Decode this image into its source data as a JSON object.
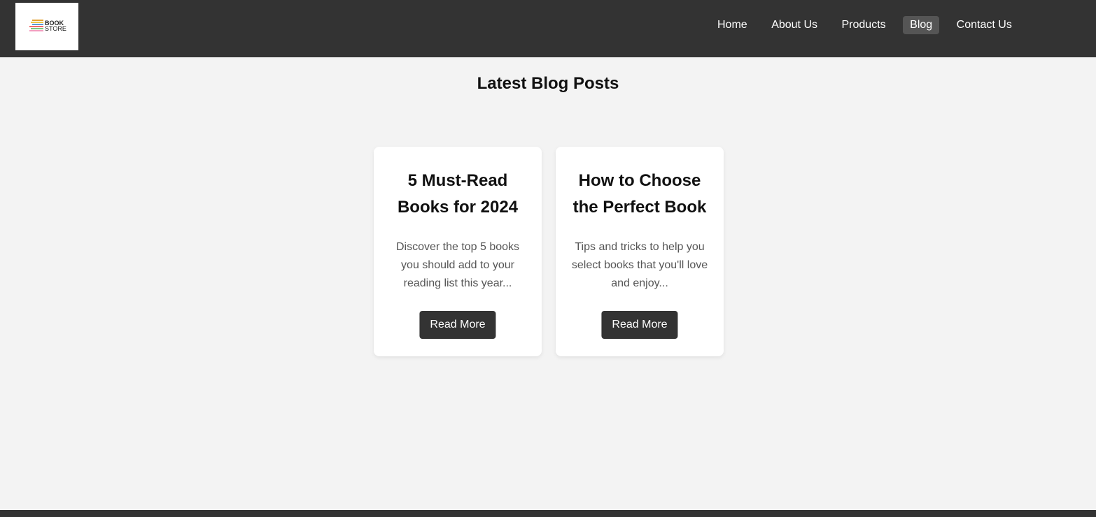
{
  "header": {
    "logo": {
      "line1": "BOOK",
      "line2": "STORE"
    },
    "nav": [
      {
        "label": "Home",
        "active": false
      },
      {
        "label": "About Us",
        "active": false
      },
      {
        "label": "Products",
        "active": false
      },
      {
        "label": "Blog",
        "active": true
      },
      {
        "label": "Contact Us",
        "active": false
      }
    ]
  },
  "main": {
    "title": "Latest Blog Posts",
    "posts": [
      {
        "title": "5 Must-Read Books for 2024",
        "excerpt": "Discover the top 5 books you should add to your reading list this year...",
        "button_label": "Read More"
      },
      {
        "title": "How to Choose the Perfect Book",
        "excerpt": "Tips and tricks to help you select books that you'll love and enjoy...",
        "button_label": "Read More"
      }
    ]
  },
  "colors": {
    "header_bg": "#333333",
    "page_bg": "#f3f3f3",
    "active_nav_bg": "#555555",
    "button_bg": "#333333"
  }
}
